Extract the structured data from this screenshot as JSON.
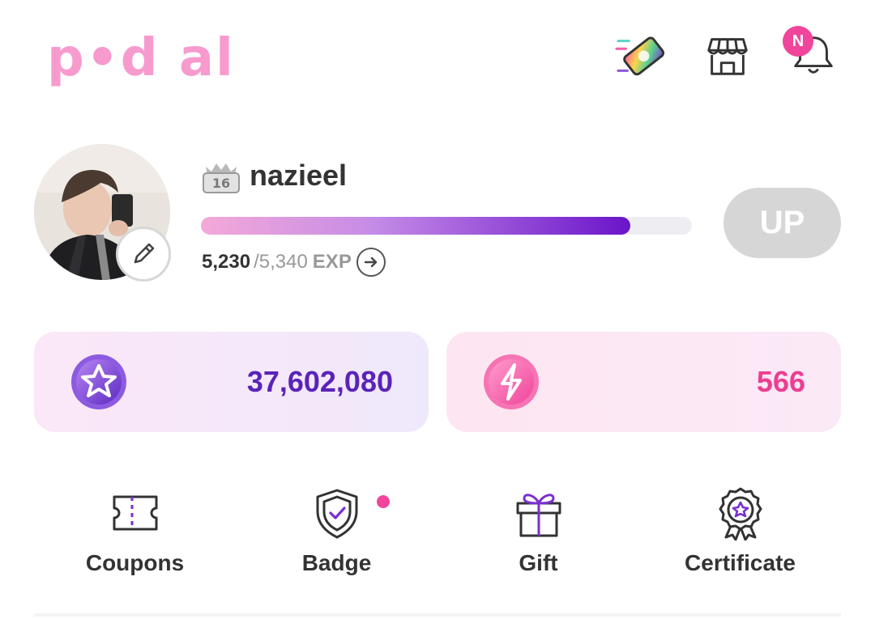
{
  "header": {
    "logo_text": "p•d al",
    "icons": [
      "ticket-pass-icon",
      "store-icon",
      "bell-icon"
    ],
    "notification_badge": "N"
  },
  "profile": {
    "username": "nazieel",
    "level": "16",
    "exp_current": "5,230",
    "exp_max": "/5,340",
    "exp_unit": "EXP",
    "exp_progress": 0.874,
    "up_label": "UP"
  },
  "balances": {
    "star_value": "37,602,080",
    "bolt_value": "566"
  },
  "menu": {
    "items": [
      {
        "label": "Coupons",
        "icon": "coupon-icon"
      },
      {
        "label": "Badge",
        "icon": "badge-shield-icon",
        "has_dot": true
      },
      {
        "label": "Gift",
        "icon": "gift-icon"
      },
      {
        "label": "Certificate",
        "icon": "certificate-icon"
      }
    ]
  },
  "colors": {
    "brand_pink": "#f79bcf",
    "accent_purple": "#5a23b8",
    "accent_pink": "#ec3e92",
    "badge_pink": "#f0459b"
  }
}
